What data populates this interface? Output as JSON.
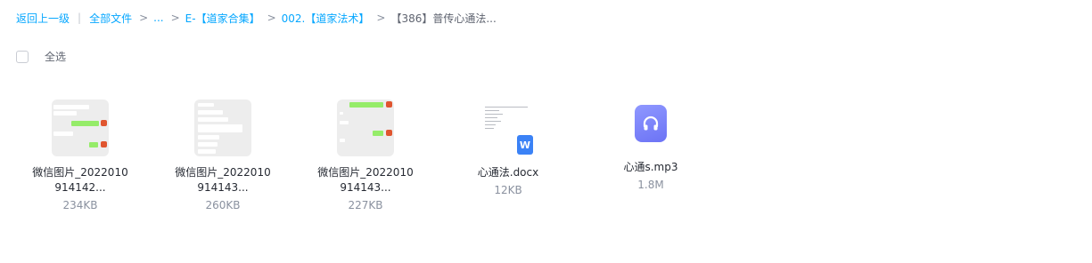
{
  "breadcrumb": {
    "back": "返回上一级",
    "all_files": "全部文件",
    "ellipsis": "...",
    "level1": "E-【道家合集】",
    "level2": "002.【道家法术】",
    "current": "【386】普传心通法...",
    "separator": ">",
    "divider": "|"
  },
  "select_all_label": "全选",
  "files": [
    {
      "name_line1": "微信图片_2022010",
      "name_line2": "914142...",
      "size": "234KB",
      "type": "image"
    },
    {
      "name_line1": "微信图片_2022010",
      "name_line2": "914143...",
      "size": "260KB",
      "type": "image"
    },
    {
      "name_line1": "微信图片_2022010",
      "name_line2": "914143...",
      "size": "227KB",
      "type": "image"
    },
    {
      "name_line1": "心通法.docx",
      "size": "12KB",
      "type": "docx",
      "badge": "W"
    },
    {
      "name_line1": "心通s.mp3",
      "size": "1.8M",
      "type": "audio"
    }
  ],
  "colors": {
    "link": "#06a7ff",
    "audio_icon": "#7b82f8",
    "word_icon": "#3b82f6"
  }
}
